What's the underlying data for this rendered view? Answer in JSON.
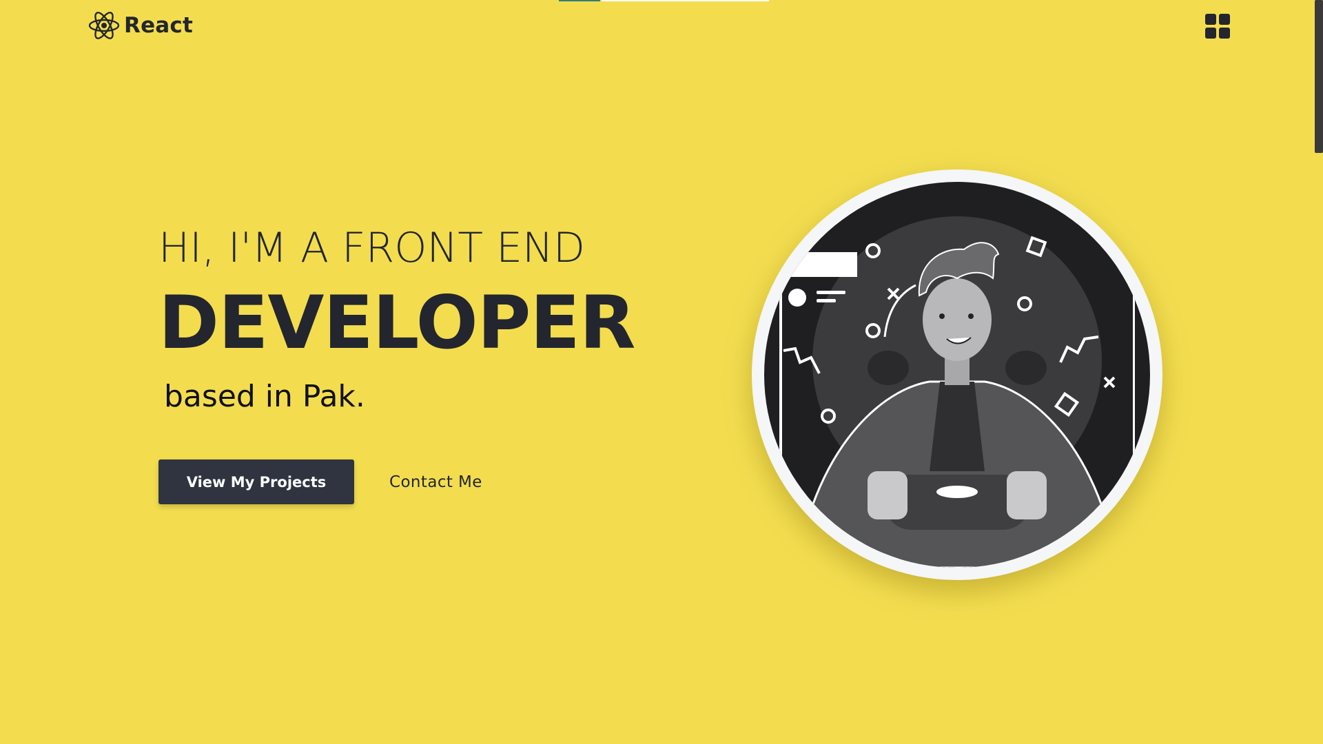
{
  "brand": {
    "name": "React",
    "logo_icon": "react-atom-icon"
  },
  "header": {
    "menu_icon": "grid-menu-icon"
  },
  "hero": {
    "line1": "HI, I'M A FRONT END",
    "line2": "DEVELOPER",
    "line3": "based in Pak."
  },
  "actions": {
    "primary_label": "View My Projects",
    "secondary_label": "Contact Me"
  },
  "illustration": {
    "name": "developer-gaming-illustration"
  },
  "colors": {
    "background": "#f3dd4f",
    "text": "#23262e",
    "button": "#2f3440",
    "accent": "#2f7d7b"
  }
}
